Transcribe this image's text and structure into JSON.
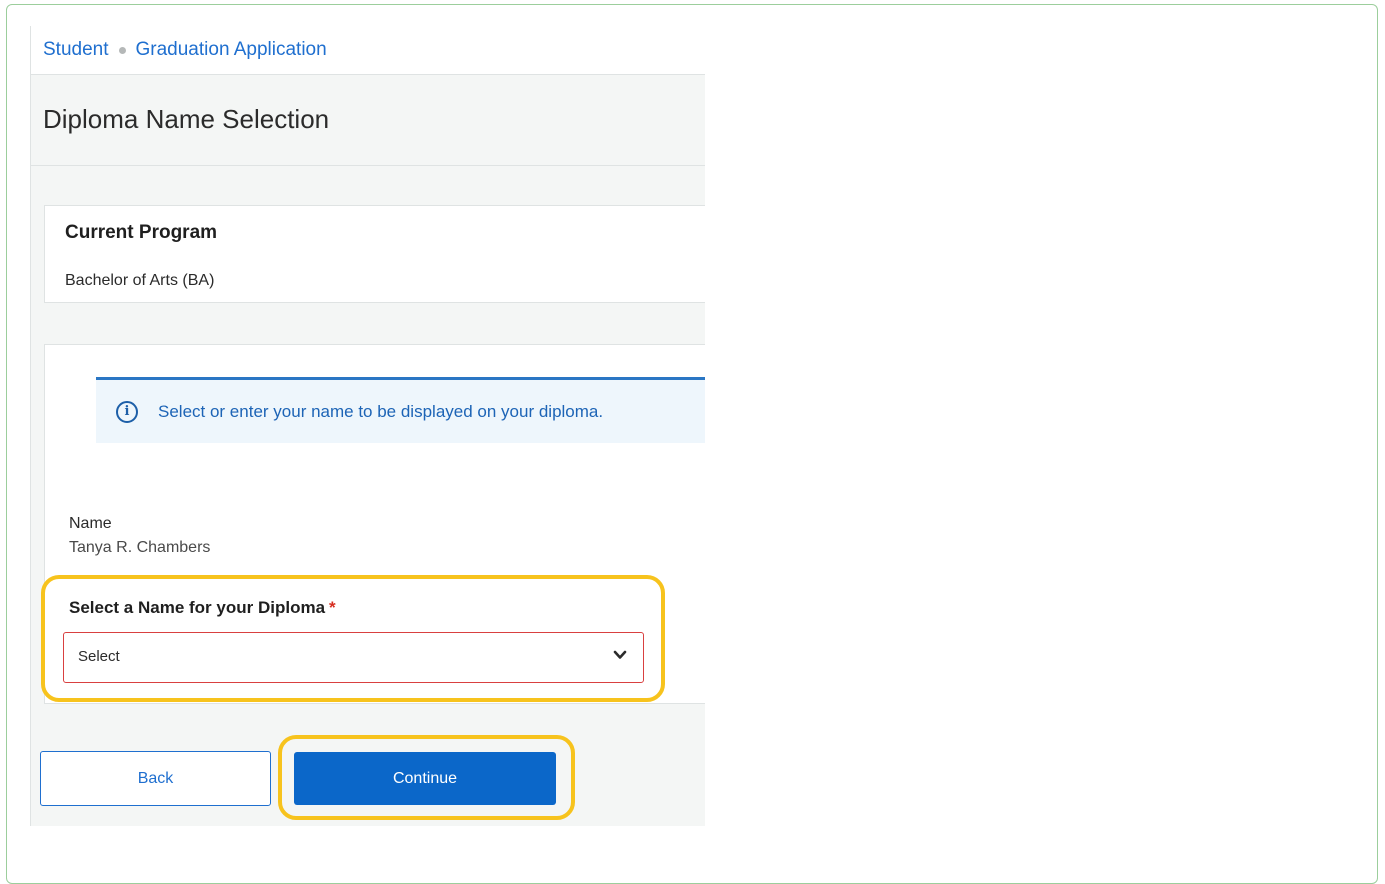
{
  "breadcrumb": {
    "items": [
      "Student",
      "Graduation Application"
    ]
  },
  "page": {
    "title": "Diploma Name Selection"
  },
  "program": {
    "heading": "Current Program",
    "value": "Bachelor of Arts (BA)"
  },
  "info_banner": {
    "icon": "info-icon",
    "text": "Select or enter your name to be displayed on your diploma."
  },
  "name": {
    "label": "Name",
    "value": "Tanya R. Chambers"
  },
  "diploma_select": {
    "label": "Select a Name for your Diploma",
    "required_marker": "*",
    "selected": "Select"
  },
  "actions": {
    "back_label": "Back",
    "continue_label": "Continue"
  },
  "colors": {
    "link": "#1f6fcf",
    "primary_button": "#0b67c9",
    "highlight": "#f7c31d",
    "error_border": "#d94040",
    "required": "#d62d20"
  }
}
